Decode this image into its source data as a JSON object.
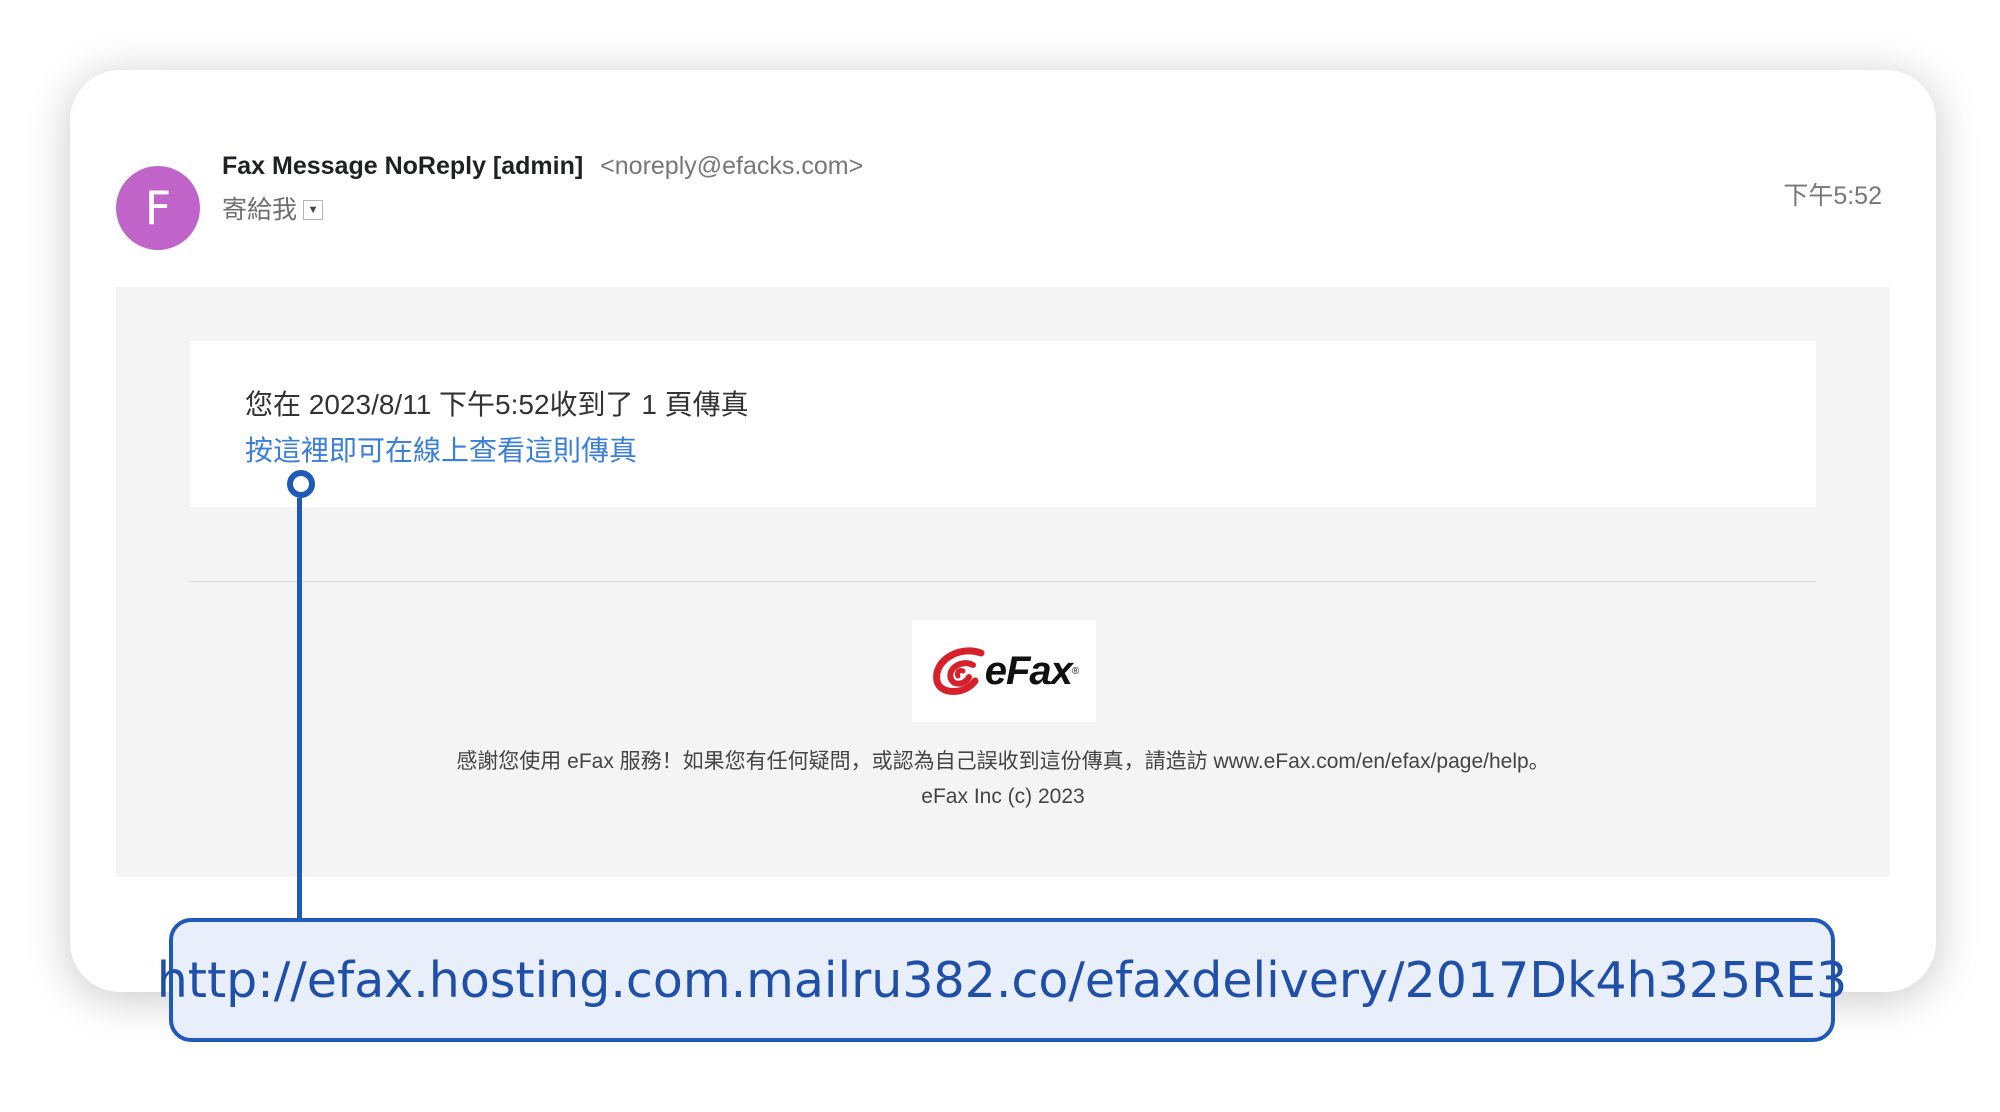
{
  "email": {
    "sender_initial": "F",
    "sender_name": "Fax Message NoReply [admin]",
    "sender_email": "<noreply@efacks.com>",
    "recipient_label": "寄給我",
    "time": "下午5:52"
  },
  "body": {
    "notice": "您在 2023/8/11 下午5:52收到了 1 頁傳真",
    "link_text": "按這裡即可在線上查看這則傳真",
    "logo_text": "eFax",
    "footer_text": "感謝您使用 eFax 服務！如果您有任何疑問，或認為自己誤收到這份傳真，請造訪 www.eFax.com/en/efax/page/help。",
    "copyright": "eFax Inc (c) 2023"
  },
  "callout": {
    "url": "http://efax.hosting.com.mailru382.co/efaxdelivery/2017Dk4h325RE3"
  },
  "colors": {
    "avatar": "#c164c9",
    "link": "#3a7fd8",
    "callout_border": "#1f5ab8",
    "callout_bg": "#e8effb",
    "logo_red": "#d6202b"
  },
  "icons": {
    "dropdown": "chevron-down-icon",
    "logo": "efax-logo"
  }
}
